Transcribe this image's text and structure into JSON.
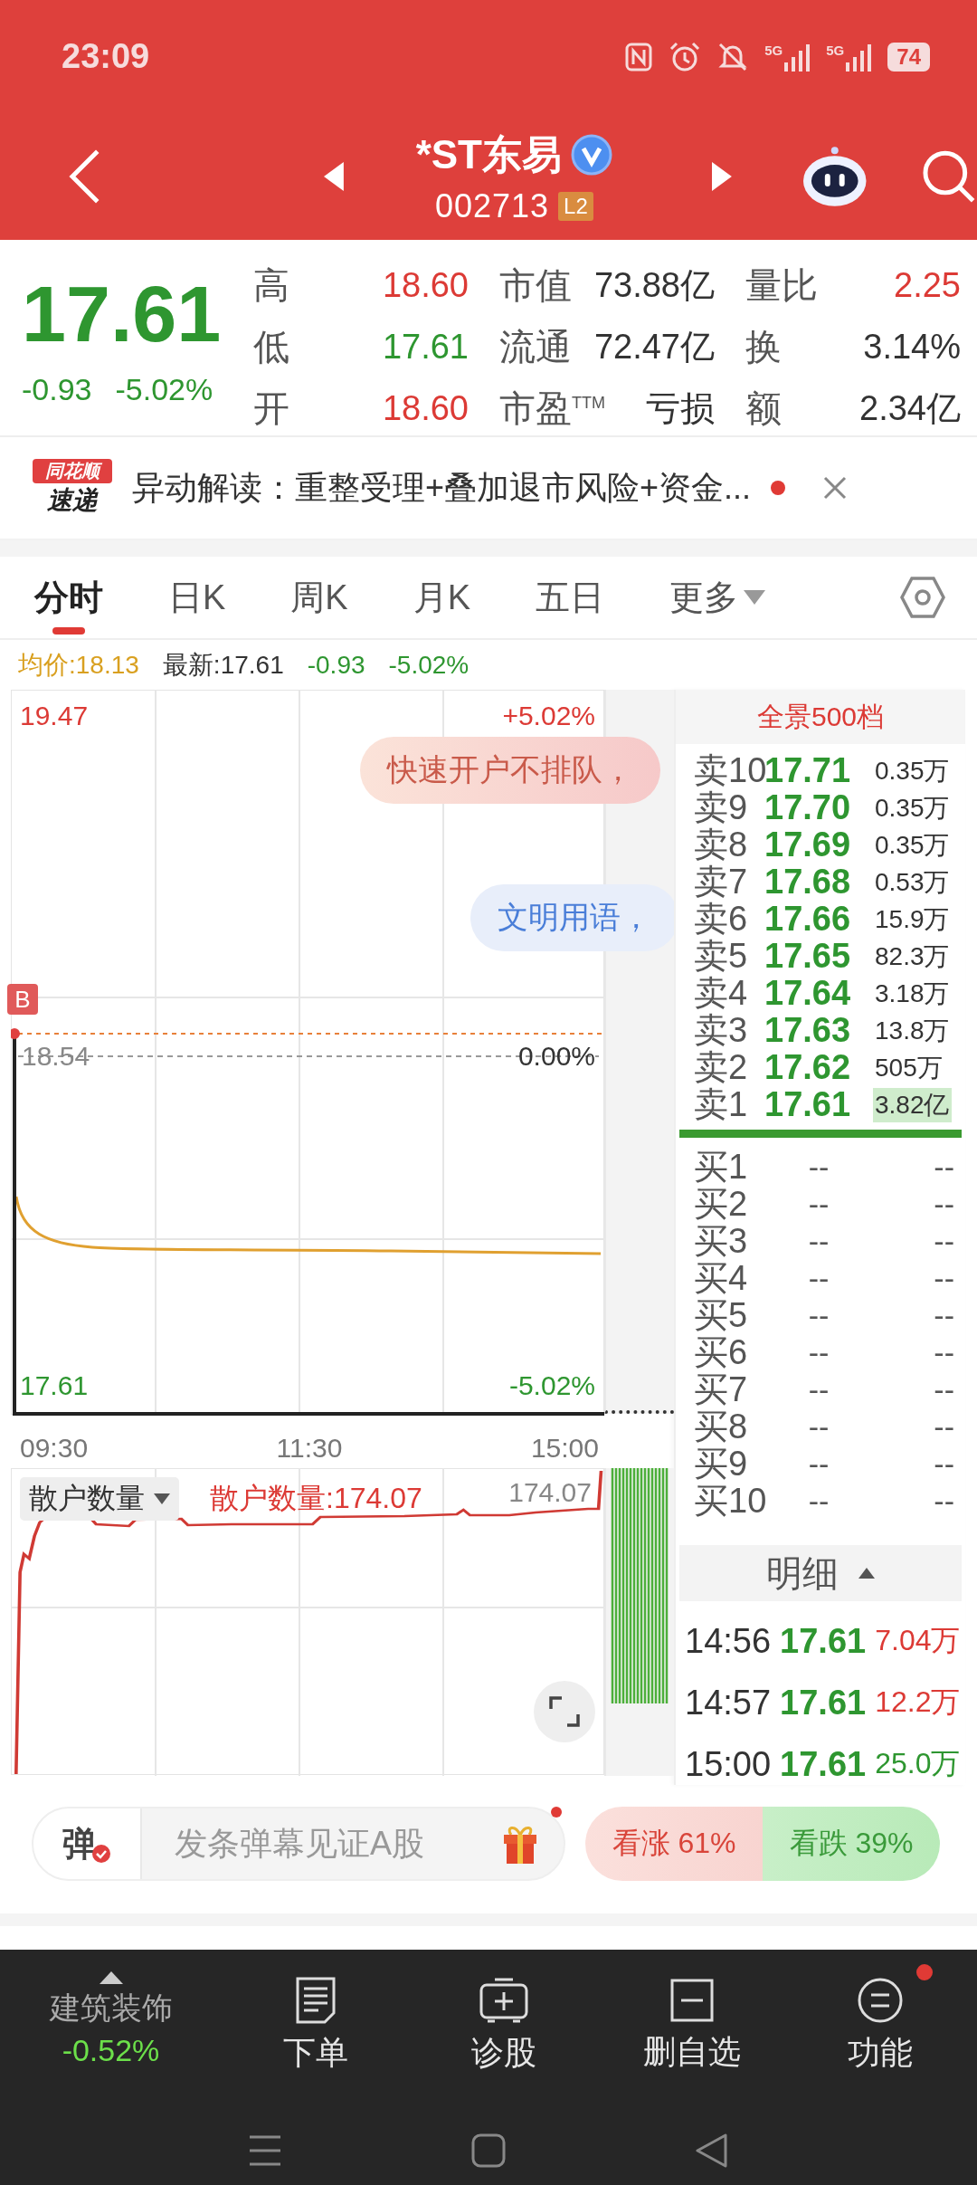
{
  "status_bar": {
    "time": "23:09",
    "networks": [
      "5G",
      "5G"
    ],
    "battery": "74"
  },
  "header": {
    "title": "*ST东易",
    "code": "002713",
    "badge": "L2"
  },
  "quote": {
    "price": "17.61",
    "change": "-0.93",
    "change_pct": "-5.02%",
    "color": "#2e9630",
    "stats": [
      {
        "label": "高",
        "value": "18.60",
        "color": "#dc3a35"
      },
      {
        "label": "市值",
        "value": "73.88亿",
        "color": "#333333"
      },
      {
        "label": "量比",
        "value": "2.25",
        "color": "#dc3a35"
      },
      {
        "label": "低",
        "value": "17.61",
        "color": "#2e9630"
      },
      {
        "label": "流通",
        "value": "72.47亿",
        "color": "#333333"
      },
      {
        "label": "换",
        "value": "3.14%",
        "color": "#333333"
      },
      {
        "label": "开",
        "value": "18.60",
        "color": "#dc3a35"
      },
      {
        "label": "市盈$^{TTM}$",
        "value": "亏损",
        "color": "#333333"
      },
      {
        "label": "额",
        "value": "2.34亿",
        "color": "#333333"
      }
    ]
  },
  "news": {
    "badge": [
      "同花顺",
      "速递"
    ],
    "text": "异动解读：重整受理+叠加退市风险+资金...",
    "unread": true
  },
  "tabs": [
    {
      "label": "分时",
      "selected": true,
      "dropdown": false
    },
    {
      "label": "日K",
      "selected": false,
      "dropdown": false
    },
    {
      "label": "周K",
      "selected": false,
      "dropdown": false
    },
    {
      "label": "月K",
      "selected": false,
      "dropdown": false
    },
    {
      "label": "五日",
      "selected": false,
      "dropdown": false
    },
    {
      "label": "更多",
      "selected": false,
      "dropdown": true
    }
  ],
  "info": [
    {
      "text": "均价:18.13",
      "color": "#d9a020"
    },
    {
      "text": "最新:17.61",
      "color": "#333333"
    },
    {
      "text": "-0.93",
      "color": "#2e9630"
    },
    {
      "text": "-5.02%",
      "color": "#2e9630"
    }
  ],
  "chart": {
    "top_price": "19.47",
    "top_pct": "+5.02%",
    "mid_price": "18.54",
    "mid_pct": "0.00%",
    "bottom_price": "17.61",
    "bottom_pct": "-5.02%",
    "marker": "B",
    "times": [
      "09:30",
      "11:30",
      "15:00"
    ]
  },
  "bubbles": [
    {
      "text": "快速开户不排队，",
      "kind": "promo"
    },
    {
      "text": "文明用语，",
      "kind": "notice"
    }
  ],
  "sub_chart": {
    "indicator": "散户数量",
    "reading": "散户数量:174.07",
    "value": "174.07"
  },
  "order_book": {
    "title": "全景500档",
    "asks": [
      {
        "label": "卖10",
        "price": "17.71",
        "volume": "0.35万",
        "highlighted": false
      },
      {
        "label": "卖9",
        "price": "17.70",
        "volume": "0.35万",
        "highlighted": false
      },
      {
        "label": "卖8",
        "price": "17.69",
        "volume": "0.35万",
        "highlighted": false
      },
      {
        "label": "卖7",
        "price": "17.68",
        "volume": "0.53万",
        "highlighted": false
      },
      {
        "label": "卖6",
        "price": "17.66",
        "volume": "15.9万",
        "highlighted": false
      },
      {
        "label": "卖5",
        "price": "17.65",
        "volume": "82.3万",
        "highlighted": false
      },
      {
        "label": "卖4",
        "price": "17.64",
        "volume": "3.18万",
        "highlighted": false
      },
      {
        "label": "卖3",
        "price": "17.63",
        "volume": "13.8万",
        "highlighted": false
      },
      {
        "label": "卖2",
        "price": "17.62",
        "volume": "505万",
        "highlighted": false
      },
      {
        "label": "卖1",
        "price": "17.61",
        "volume": "3.82亿",
        "highlighted": true
      }
    ],
    "bids": [
      {
        "label": "买1",
        "price": "--",
        "volume": "--"
      },
      {
        "label": "买2",
        "price": "--",
        "volume": "--"
      },
      {
        "label": "买3",
        "price": "--",
        "volume": "--"
      },
      {
        "label": "买4",
        "price": "--",
        "volume": "--"
      },
      {
        "label": "买5",
        "price": "--",
        "volume": "--"
      },
      {
        "label": "买6",
        "price": "--",
        "volume": "--"
      },
      {
        "label": "买7",
        "price": "--",
        "volume": "--"
      },
      {
        "label": "买8",
        "price": "--",
        "volume": "--"
      },
      {
        "label": "买9",
        "price": "--",
        "volume": "--"
      },
      {
        "label": "买10",
        "price": "--",
        "volume": "--"
      }
    ]
  },
  "trades_header": "明细",
  "trades": [
    {
      "time": "14:56",
      "price": "17.61",
      "volume": "7.04万",
      "color": "#dc3a35"
    },
    {
      "time": "14:57",
      "price": "17.61",
      "volume": "12.2万",
      "color": "#dc3a35"
    },
    {
      "time": "15:00",
      "price": "17.61",
      "volume": "25.0万",
      "color": "#2e9630"
    }
  ],
  "danmu": {
    "badge": "弹",
    "placeholder": "发条弹幕见证A股",
    "notice": true
  },
  "sentiment": [
    {
      "label": "看涨 61%",
      "kind": "bull"
    },
    {
      "label": "看跌 39%",
      "kind": "bear"
    }
  ],
  "sector": {
    "name": "建筑装饰",
    "change": "-0.52%"
  },
  "nav": [
    {
      "label": "下单",
      "kind": "order",
      "badge": false
    },
    {
      "label": "诊股",
      "kind": "diagnose",
      "badge": false
    },
    {
      "label": "删自选",
      "kind": "remove",
      "badge": false
    },
    {
      "label": "功能",
      "kind": "menu",
      "badge": true
    }
  ]
}
